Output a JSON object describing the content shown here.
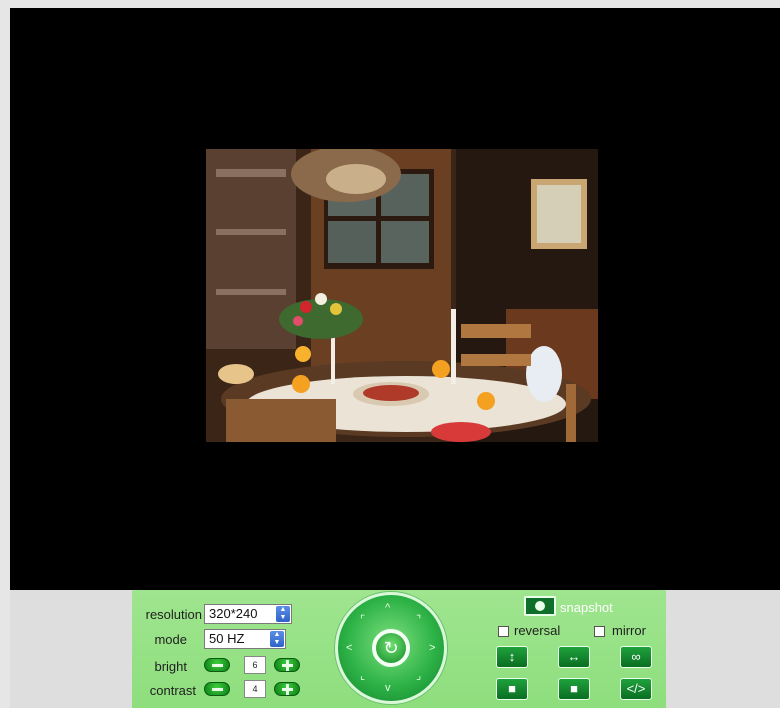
{
  "controls": {
    "resolution": {
      "label": "resolution",
      "value": "320*240"
    },
    "mode": {
      "label": "mode",
      "value": "50 HZ"
    },
    "bright": {
      "label": "bright",
      "value": "6"
    },
    "contrast": {
      "label": "contrast",
      "value": "4"
    }
  },
  "snapshot": {
    "label": "snapshot"
  },
  "options": {
    "reversal": "reversal",
    "mirror": "mirror"
  },
  "colors": {
    "panel": "#9fe58f",
    "button": "#0a6e22",
    "video_bg": "#000000"
  },
  "icons": {
    "ptz": [
      "up-arrow-icon",
      "down-arrow-icon",
      "left-arrow-icon",
      "right-arrow-icon",
      "center-refresh-icon"
    ],
    "buttons": [
      "vertical-flip-icon",
      "horizontal-flip-icon",
      "infinity-icon",
      "square-icon",
      "square-icon",
      "code-icon"
    ]
  }
}
